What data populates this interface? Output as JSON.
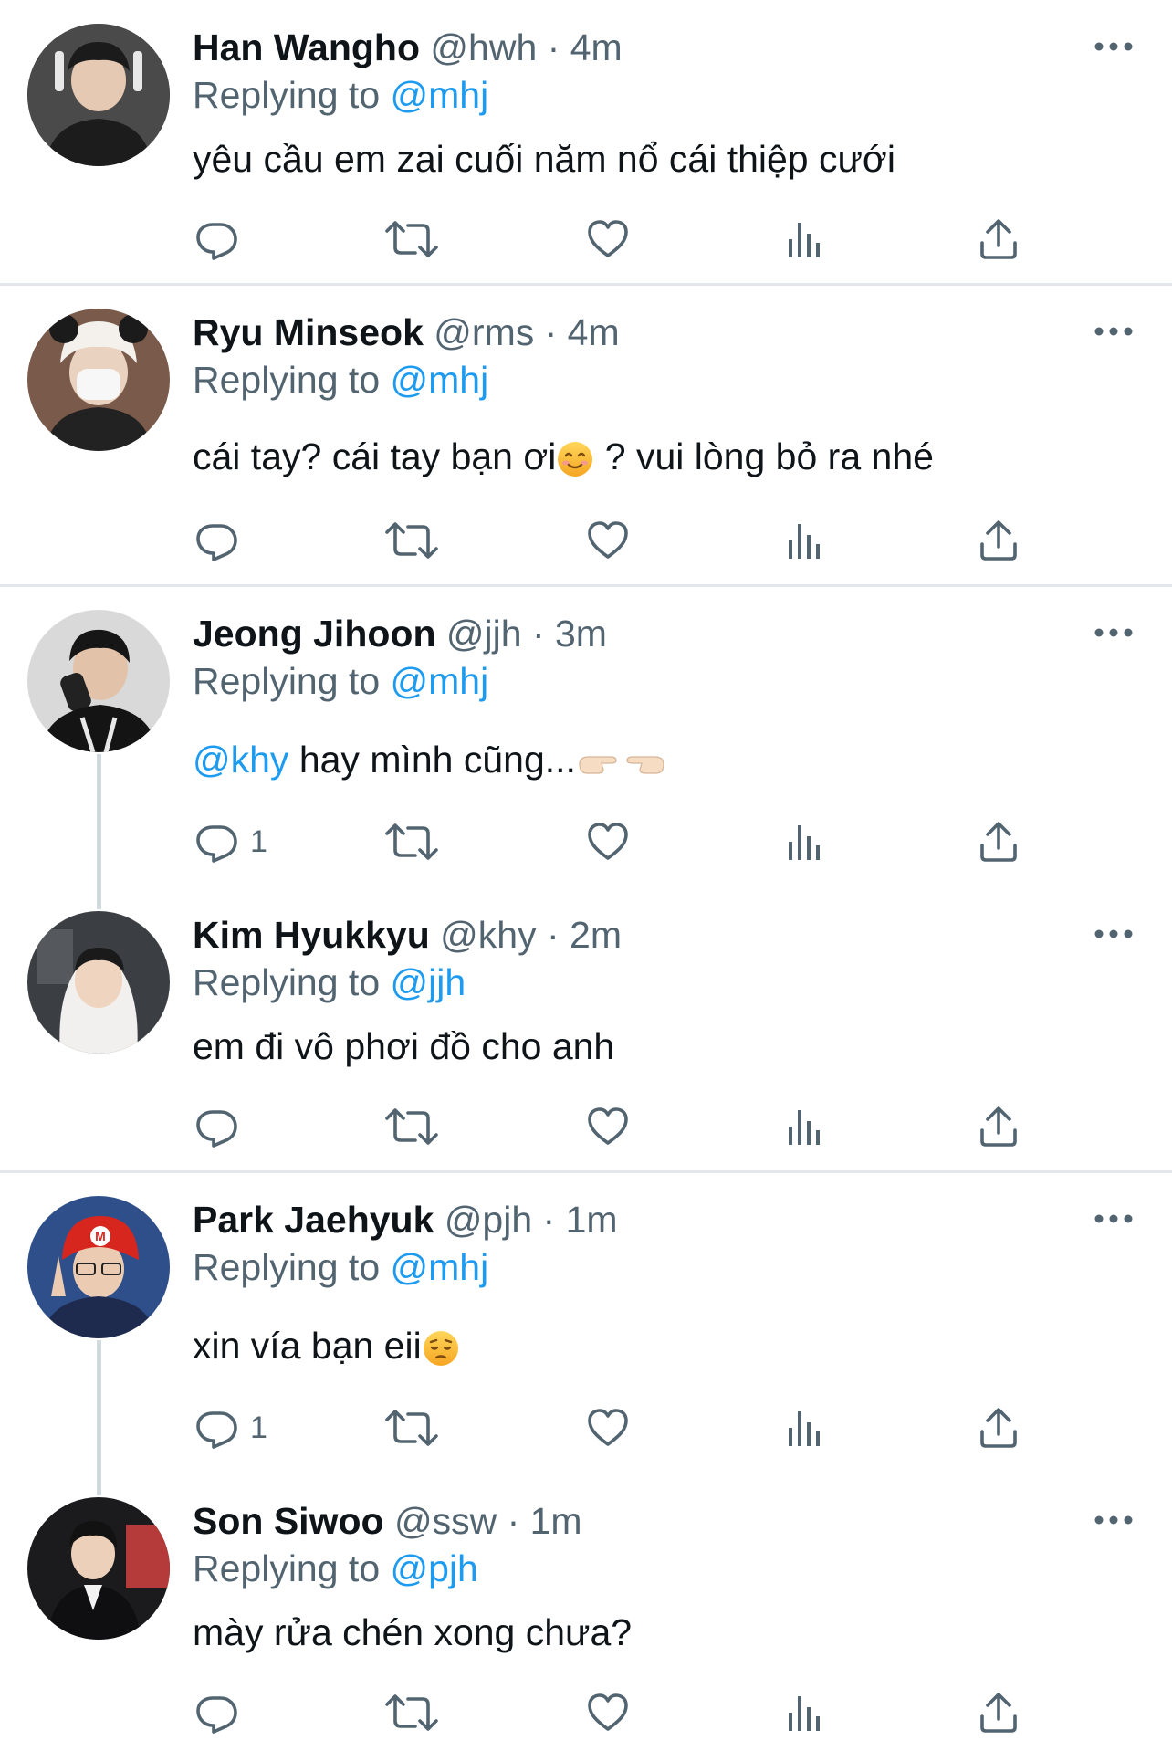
{
  "colors": {
    "accent": "#1d9bf0",
    "muted": "#536471",
    "text": "#0f1419",
    "divider": "#e3e6ea",
    "thread": "#cfd9de"
  },
  "icons": {
    "reply": "reply-icon",
    "retweet": "retweet-icon",
    "like": "heart-icon",
    "analytics": "analytics-icon",
    "share": "share-icon",
    "more": "more-icon"
  },
  "tweets": [
    {
      "name": "Han Wangho",
      "meta": "@hwh · 4m",
      "replying_prefix": "Replying to ",
      "replying_handle": "@mhj",
      "text": "yêu cầu em zai cuối năm nổ cái thiệp cưới",
      "reply_count": ""
    },
    {
      "name": "Ryu Minseok",
      "meta": "@rms · 4m",
      "replying_prefix": "Replying to ",
      "replying_handle": "@mhj",
      "text_before": "cái tay? cái tay bạn ơi",
      "text_after": " ? vui lòng bỏ ra nhé",
      "emoji": "smiling-face-emoji",
      "reply_count": ""
    },
    {
      "name": "Jeong Jihoon",
      "meta": "@jjh · 3m",
      "replying_prefix": "Replying to ",
      "replying_handle": "@mhj",
      "mention": "@khy",
      "text": " hay mình cũng...",
      "emoji": "pointing-hands-emoji",
      "reply_count": "1"
    },
    {
      "name": "Kim Hyukkyu",
      "meta": "@khy · 2m",
      "replying_prefix": "Replying to ",
      "replying_handle": "@jjh",
      "text": "em đi vô phơi đồ cho anh",
      "reply_count": ""
    },
    {
      "name": "Park Jaehyuk",
      "meta": "@pjh · 1m",
      "replying_prefix": "Replying to ",
      "replying_handle": "@mhj",
      "text": "xin vía bạn eii",
      "emoji": "pensive-face-emoji",
      "reply_count": "1"
    },
    {
      "name": "Son Siwoo",
      "meta": "@ssw · 1m",
      "replying_prefix": "Replying to ",
      "replying_handle": "@pjh",
      "text": "mày rửa chén xong chưa?",
      "reply_count": ""
    }
  ]
}
